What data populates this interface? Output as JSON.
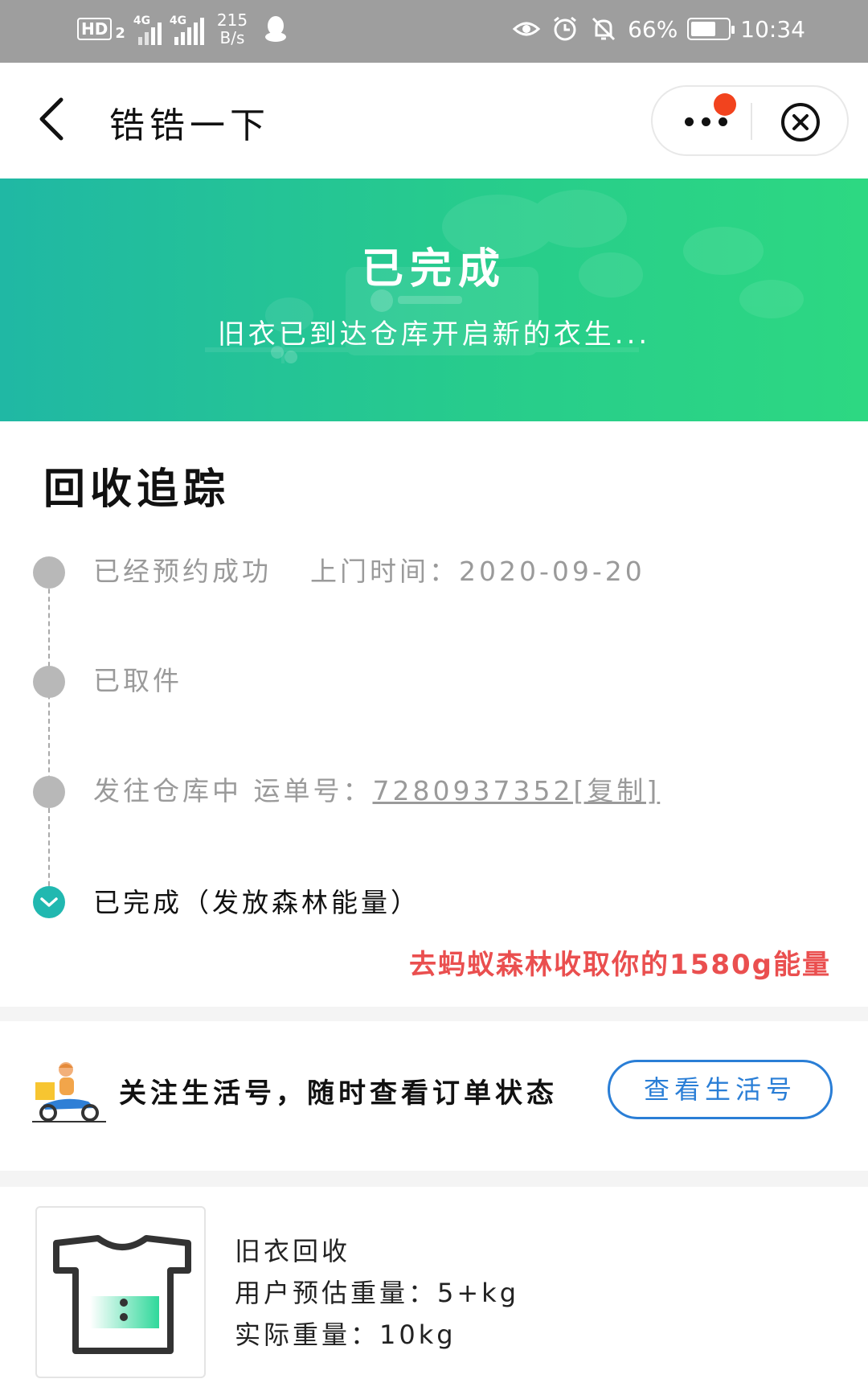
{
  "status_bar": {
    "hd": "HD",
    "hd_sim": "2",
    "net1": "4G",
    "net2": "4G",
    "speed_value": "215",
    "speed_unit": "B/s",
    "battery_pct": "66%",
    "time": "10:34"
  },
  "nav": {
    "title": "锆锆一下"
  },
  "banner": {
    "title": "已完成",
    "subtitle": "旧衣已到达仓库开启新的衣生..."
  },
  "tracking": {
    "title": "回收追踪",
    "steps": [
      {
        "label": "已经预约成功",
        "detail": "上门时间：2020-09-20"
      },
      {
        "label": "已取件"
      },
      {
        "label": "发往仓库中",
        "detail_prefix": "运单号：",
        "link": "7280937352[复制]"
      },
      {
        "label": "已完成（发放森林能量）"
      }
    ],
    "energy_tip": "去蚂蚁森林收取你的1580g能量"
  },
  "follow": {
    "text": "关注生活号，随时查看订单状态",
    "button": "查看生活号"
  },
  "item": {
    "name": "旧衣回收",
    "estimate": "用户预估重量：5+kg",
    "actual": "实际重量：10kg"
  },
  "colors": {
    "accent_green": "#27cc8c",
    "done_teal": "#21b8b0",
    "energy_red": "#ea4f4f",
    "button_blue": "#2a7ed6"
  }
}
